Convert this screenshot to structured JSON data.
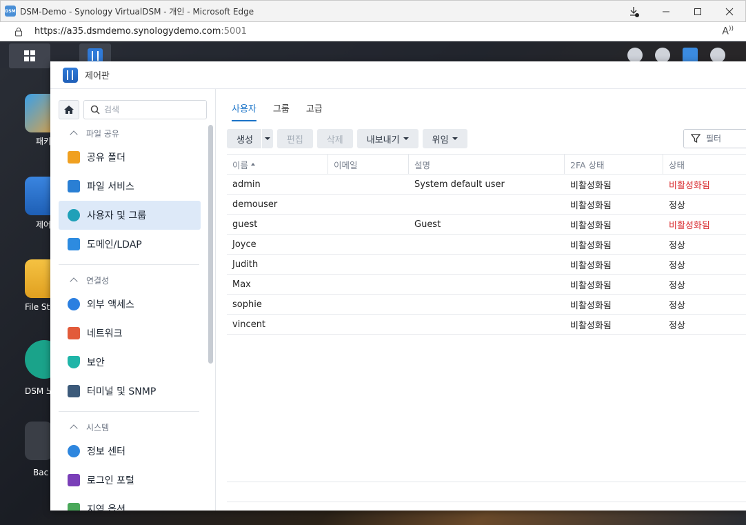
{
  "browser": {
    "favicon": "DSM",
    "title": "DSM-Demo - Synology VirtualDSM - 개인 - Microsoft Edge",
    "url_main": "https://a35.dsmdemo.synologydemo.com",
    "url_port": ":5001"
  },
  "desktop": {
    "items": [
      {
        "label": "패키\n센"
      },
      {
        "label": "제어"
      },
      {
        "label": "File St"
      },
      {
        "label": "DSM 노"
      },
      {
        "label": "Bac"
      }
    ]
  },
  "window": {
    "title": "제어판"
  },
  "sidebar": {
    "search_placeholder": "검색",
    "sections": [
      {
        "title": "파일 공유",
        "items": [
          {
            "label": "공유 폴더",
            "icon": "folder-icon",
            "color": "#f0a020"
          },
          {
            "label": "파일 서비스",
            "icon": "file-services-icon",
            "color": "#2a7fd4"
          },
          {
            "label": "사용자 및 그룹",
            "icon": "users-icon",
            "color": "#1fa0b8"
          },
          {
            "label": "도메인/LDAP",
            "icon": "domain-icon",
            "color": "#2d8be0"
          }
        ]
      },
      {
        "title": "연결성",
        "items": [
          {
            "label": "외부 액세스",
            "icon": "external-access-icon",
            "color": "#2b7fe0"
          },
          {
            "label": "네트워크",
            "icon": "network-icon",
            "color": "#e25b3a"
          },
          {
            "label": "보안",
            "icon": "shield-icon",
            "color": "#1fb5a8"
          },
          {
            "label": "터미널 및 SNMP",
            "icon": "terminal-icon",
            "color": "#3c5a7a"
          }
        ]
      },
      {
        "title": "시스템",
        "items": [
          {
            "label": "정보 센터",
            "icon": "info-icon",
            "color": "#2e86de"
          },
          {
            "label": "로그인 포털",
            "icon": "login-portal-icon",
            "color": "#7a3fb8"
          },
          {
            "label": "지역 옵션",
            "icon": "region-icon",
            "color": "#4aa85a"
          }
        ]
      }
    ]
  },
  "tabs": [
    "사용자",
    "그룹",
    "고급"
  ],
  "toolbar": {
    "create": "생성",
    "edit": "편집",
    "delete": "삭제",
    "export": "내보내기",
    "delegate": "위임",
    "filter_placeholder": "필터"
  },
  "table": {
    "columns": [
      "이름",
      "이메일",
      "설명",
      "2FA 상태",
      "상태"
    ],
    "rows": [
      {
        "name": "admin",
        "email": "",
        "desc": "System default user",
        "twofa": "비활성화됨",
        "status": "비활성화됨",
        "status_color": "#d8282c"
      },
      {
        "name": "demouser",
        "email": "",
        "desc": "",
        "twofa": "비활성화됨",
        "status": "정상",
        "status_color": "#222222"
      },
      {
        "name": "guest",
        "email": "",
        "desc": "Guest",
        "twofa": "비활성화됨",
        "status": "비활성화됨",
        "status_color": "#d8282c"
      },
      {
        "name": "Joyce",
        "email": "",
        "desc": "",
        "twofa": "비활성화됨",
        "status": "정상",
        "status_color": "#222222"
      },
      {
        "name": "Judith",
        "email": "",
        "desc": "",
        "twofa": "비활성화됨",
        "status": "정상",
        "status_color": "#222222"
      },
      {
        "name": "Max",
        "email": "",
        "desc": "",
        "twofa": "비활성화됨",
        "status": "정상",
        "status_color": "#222222"
      },
      {
        "name": "sophie",
        "email": "",
        "desc": "",
        "twofa": "비활성화됨",
        "status": "정상",
        "status_color": "#222222"
      },
      {
        "name": "vincent",
        "email": "",
        "desc": "",
        "twofa": "비활성화됨",
        "status": "정상",
        "status_color": "#222222"
      }
    ]
  }
}
